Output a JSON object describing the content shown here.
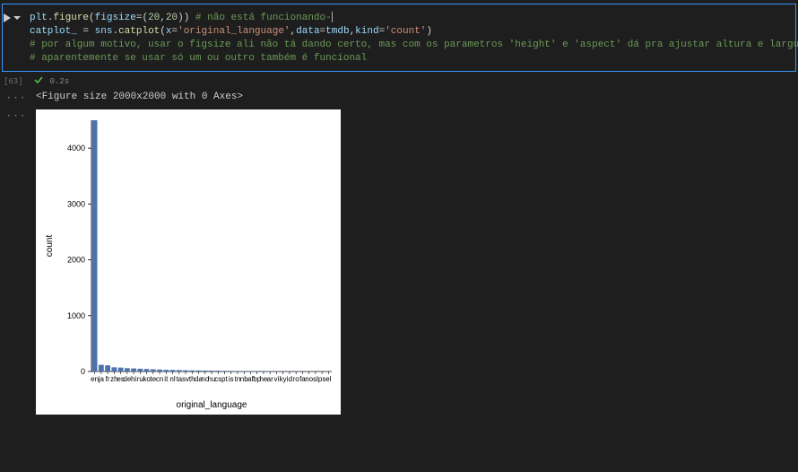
{
  "cell": {
    "exec_count": "[63]",
    "exec_time": "0.2s",
    "code": {
      "line1": {
        "pre": "plt",
        "dot1": ".",
        "fn1": "figure",
        "open1": "(",
        "kw1": "figsize",
        "eq1": "=",
        "open2": "(",
        "n1": "20",
        "comma1": ",",
        "n2": "20",
        "close2": ")",
        "close1": ")",
        "comment": " # não está funcionando-"
      },
      "line2": {
        "var": "catplot_",
        "sp1": " ",
        "eq": "=",
        "sp2": " ",
        "obj": "sns",
        "dot": ".",
        "fn": "catplot",
        "open": "(",
        "k1": "x",
        "e1": "=",
        "s1": "'original_language'",
        "c1": ",",
        "k2": "data",
        "e2": "=",
        "v2": "tmdb",
        "c2": ",",
        "k3": "kind",
        "e3": "=",
        "s3": "'count'",
        "close": ")"
      },
      "line3": "# por algum motivo, usar o figsize ali não tá dando certo, mas com os parametros 'height' e 'aspect' dá pra ajustar altura e largura respectivamente",
      "line4": "# aparentemente se usar só um ou outro também é funcional"
    }
  },
  "output_text": "<Figure size 2000x2000 with 0 Axes>",
  "chart_data": {
    "type": "bar",
    "xlabel": "original_language",
    "ylabel": "count",
    "ylim": [
      0,
      4500
    ],
    "yticks": [
      0,
      1000,
      2000,
      3000,
      4000
    ],
    "categories": [
      "en",
      "ja",
      "fr",
      "zh",
      "es",
      "de",
      "hi",
      "ru",
      "ko",
      "te",
      "cn",
      "it",
      "nl",
      "ta",
      "sv",
      "th",
      "da",
      "no",
      "hu",
      "cs",
      "pt",
      "is",
      "tn",
      "nb",
      "af",
      "bp",
      "he",
      "ar",
      "vi",
      "ky",
      "id",
      "ro",
      "fa",
      "no",
      "sl",
      "ps",
      "el"
    ],
    "values": [
      4500,
      120,
      110,
      75,
      70,
      60,
      55,
      50,
      45,
      40,
      35,
      30,
      28,
      25,
      22,
      20,
      18,
      16,
      15,
      14,
      12,
      10,
      9,
      8,
      8,
      7,
      7,
      6,
      6,
      5,
      5,
      5,
      4,
      4,
      3,
      3,
      2
    ]
  }
}
